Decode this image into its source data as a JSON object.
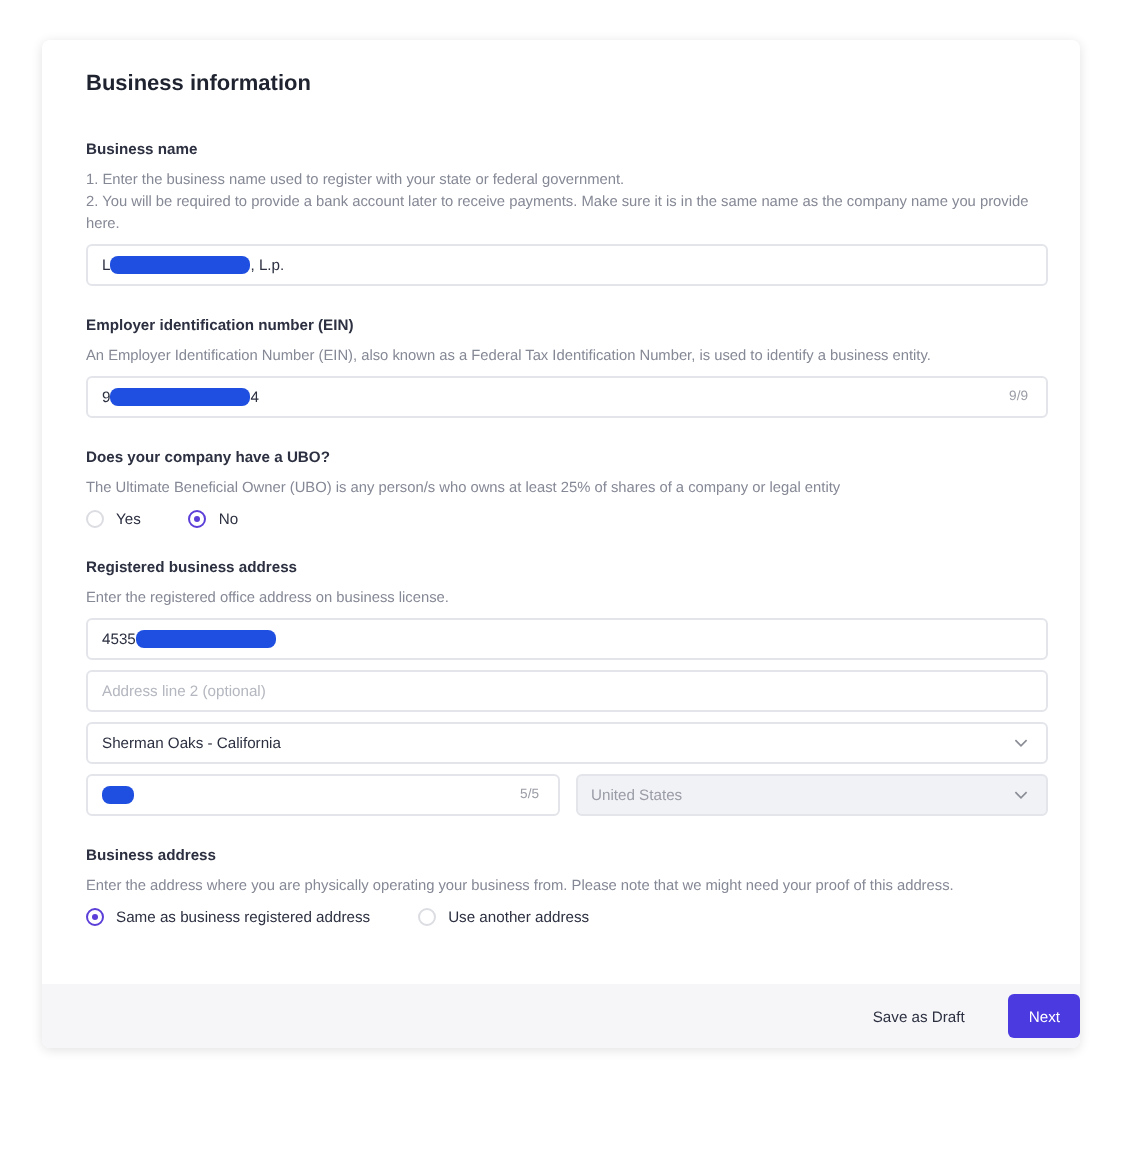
{
  "title": "Business information",
  "sections": [
    {
      "kind": "text",
      "label": "Business name",
      "descriptions": [
        "1. Enter the business name used to register with your state or federal government.",
        "2. You will be required to provide a bank account later to receive payments. Make sure it is in the same name as the company name you provide here."
      ],
      "fields": [
        {
          "kind": "input",
          "value_parts": [
            {
              "kind": "text",
              "text": "L"
            },
            {
              "kind": "redacted"
            },
            {
              "kind": "text",
              "text": ", L.p."
            }
          ]
        }
      ]
    },
    {
      "kind": "text",
      "label": "Employer identification number (EIN)",
      "descriptions": [
        "An Employer Identification Number (EIN), also known as a Federal Tax Identification Number, is used to identify a business entity."
      ],
      "fields": [
        {
          "kind": "input",
          "value_parts": [
            {
              "kind": "text",
              "text": "9"
            },
            {
              "kind": "redacted"
            },
            {
              "kind": "text",
              "text": "4"
            }
          ],
          "counter": "9/9"
        }
      ]
    },
    {
      "kind": "radio",
      "label": "Does your company have a UBO?",
      "descriptions": [
        "The Ultimate Beneficial Owner (UBO) is any person/s who owns at least 25% of shares of a company or legal entity"
      ],
      "options": [
        {
          "label": "Yes",
          "selected": false
        },
        {
          "label": "No",
          "selected": true
        }
      ]
    },
    {
      "kind": "text",
      "label": "Registered business address",
      "descriptions": [
        "Enter the registered office address on business license."
      ],
      "fields": [
        {
          "kind": "input",
          "value_parts": [
            {
              "kind": "text",
              "text": "4535"
            },
            {
              "kind": "redacted"
            }
          ]
        },
        {
          "kind": "input",
          "placeholder": "Address line 2 (optional)"
        },
        {
          "kind": "select",
          "value": "Sherman Oaks - California"
        },
        {
          "kind": "pair",
          "items": [
            {
              "kind": "input",
              "value_parts": [
                {
                  "kind": "redacted"
                }
              ],
              "counter": "5/5"
            },
            {
              "kind": "select",
              "value": "United States",
              "disabled": true
            }
          ]
        }
      ]
    },
    {
      "kind": "radio",
      "label": "Business address",
      "descriptions": [
        "Enter the address where you are physically operating your business from. Please note that we might need your proof of this address."
      ],
      "options": [
        {
          "label": "Same as business registered address",
          "selected": true
        },
        {
          "label": "Use another address",
          "selected": false
        }
      ]
    }
  ],
  "footer": {
    "buttons": [
      {
        "kind": "secondary",
        "label": "Save as Draft"
      },
      {
        "kind": "primary",
        "label": "Next"
      }
    ]
  }
}
